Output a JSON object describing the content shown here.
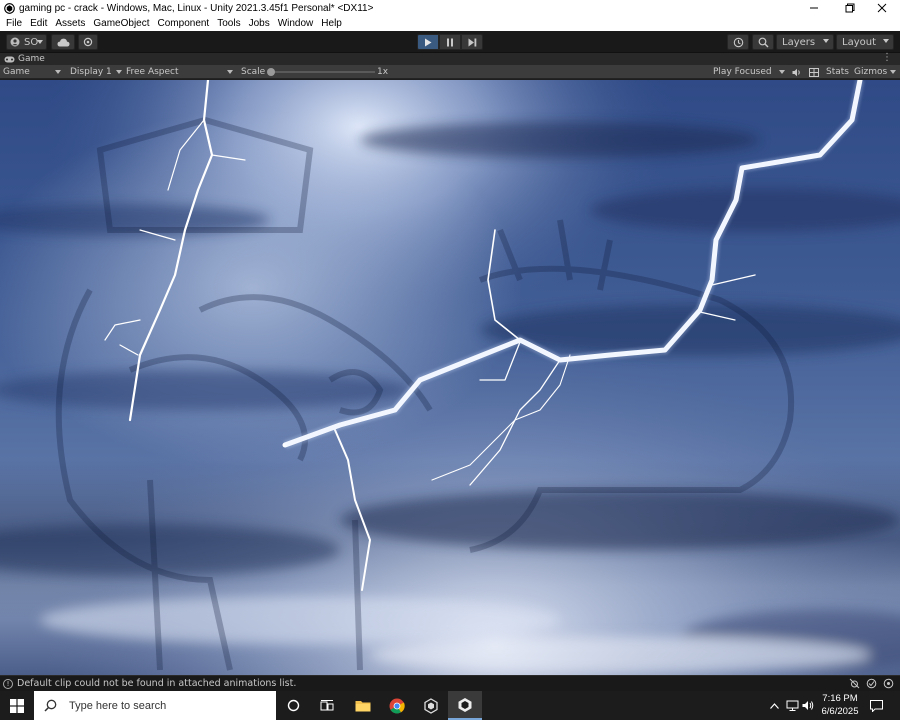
{
  "window": {
    "title": "gaming pc - crack - Windows, Mac, Linux - Unity 2021.3.45f1 Personal* <DX11>"
  },
  "menu": {
    "items": [
      "File",
      "Edit",
      "Assets",
      "GameObject",
      "Component",
      "Tools",
      "Jobs",
      "Window",
      "Help"
    ]
  },
  "toolbar": {
    "account_label": "SO",
    "layers_label": "Layers",
    "layout_label": "Layout"
  },
  "game_tab": {
    "label": "Game"
  },
  "game_controls": {
    "view_mode": "Game",
    "display": "Display 1",
    "aspect": "Free Aspect",
    "scale_label": "Scale",
    "scale_value": "1x",
    "play_mode": "Play Focused",
    "stats_label": "Stats",
    "gizmos_label": "Gizmos"
  },
  "status": {
    "message": "Default clip could not be found in attached animations list."
  },
  "taskbar": {
    "search_placeholder": "Type here to search",
    "time": "7:16 PM",
    "date": "6/6/2025"
  },
  "colors": {
    "editor_bg": "#191919",
    "play_active": "#3a5a80",
    "sky_dark": "#1f2f55",
    "sky_light": "#c9d6ee"
  }
}
